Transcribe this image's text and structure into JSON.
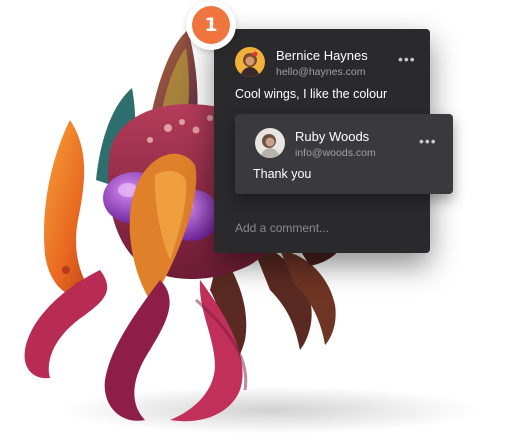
{
  "marker": {
    "number": "1"
  },
  "comment": {
    "author": "Bernice Haynes",
    "email": "hello@haynes.com",
    "text": "Cool wings, I like the colour",
    "menu_icon": "more-horizontal-icon"
  },
  "reply": {
    "author": "Ruby Woods",
    "email": "info@woods.com",
    "text": "Thank you",
    "menu_icon": "more-horizontal-icon"
  },
  "composer": {
    "placeholder": "Add a comment..."
  },
  "colors": {
    "accent": "#f0743e",
    "panel": "#2a2a2d",
    "reply_panel": "#3a3a3e",
    "creature_body": "#8e2a4a",
    "creature_horn": "#e8661f",
    "creature_eye": "#9b3fc4"
  }
}
